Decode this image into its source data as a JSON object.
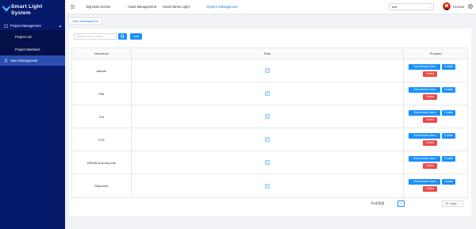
{
  "app": {
    "title_line1": "Smart Light",
    "title_line2": "System"
  },
  "sidebar": {
    "group": {
      "label": "Project Management",
      "caret": "▲"
    },
    "subitems": [
      {
        "label": "Project List"
      },
      {
        "label": "Project Members"
      }
    ],
    "active_item": {
      "label": "User Management"
    }
  },
  "header": {
    "nav": [
      {
        "label": "Big Date Screen"
      },
      {
        "label": "Asset Management"
      },
      {
        "label": "Smart Street Light"
      },
      {
        "label": "System Management"
      }
    ],
    "select_value": "test",
    "username": "ROSUN"
  },
  "tabs": [
    {
      "label": "User Management"
    }
  ],
  "toolbar": {
    "search_placeholder": "Please enter a name",
    "add_label": "Add"
  },
  "table": {
    "headers": {
      "username": "Username",
      "role": "Role",
      "proceed": "Proceed"
    },
    "rows": [
      {
        "username": "alanxie",
        "role": "I"
      },
      {
        "username": "PMI",
        "role": "I"
      },
      {
        "username": "TDI",
        "role": "I"
      },
      {
        "username": "FLR",
        "role": "I"
      },
      {
        "username": "REMALA smart pole",
        "role": "I"
      },
      {
        "username": "Raymond",
        "role": "I"
      }
    ],
    "actions": {
      "subordinate": "Subordinate Users",
      "enable": "Enable",
      "delete": "Delete"
    }
  },
  "pagination": {
    "total": "共6条数据",
    "current_page": "1",
    "page_size": "10 / page",
    "prev": "‹",
    "next": "›"
  },
  "colors": {
    "sidebar_bg": "#061a6b",
    "primary": "#1890ff",
    "danger": "#ed4a4a",
    "active_menu": "#2a4fb2"
  },
  "icons": [
    "logo-icon",
    "folder-icon",
    "user-icon",
    "hamburger-icon",
    "search-icon",
    "globe-icon",
    "chevron-down-icon"
  ]
}
